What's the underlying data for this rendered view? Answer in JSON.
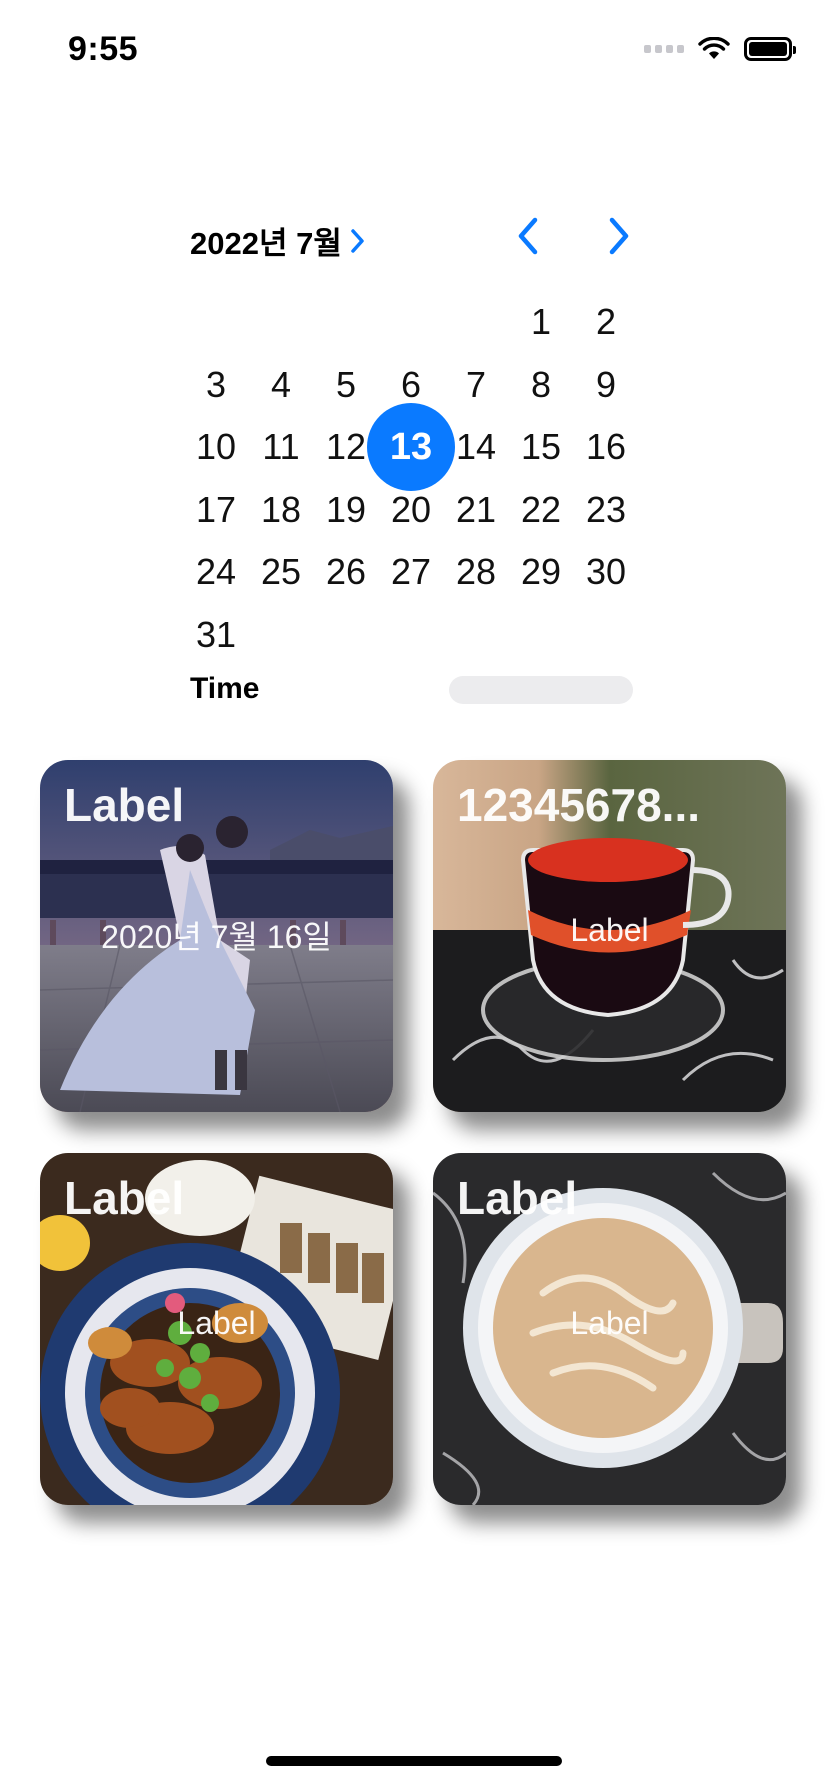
{
  "status": {
    "time": "9:55"
  },
  "calendar": {
    "month_title": "2022년 7월",
    "selected_day": 13,
    "days": [
      1,
      2,
      3,
      4,
      5,
      6,
      7,
      8,
      9,
      10,
      11,
      12,
      13,
      14,
      15,
      16,
      17,
      18,
      19,
      20,
      21,
      22,
      23,
      24,
      25,
      26,
      27,
      28,
      29,
      30,
      31
    ]
  },
  "time_row": {
    "label": "Time"
  },
  "cards": [
    {
      "title": "Label",
      "subtitle": "2020년 7월 16일"
    },
    {
      "title": "12345678...",
      "subtitle": "Label"
    },
    {
      "title": "Label",
      "subtitle": "Label"
    },
    {
      "title": "Label",
      "subtitle": "Label"
    }
  ],
  "colors": {
    "accent": "#0a7aff"
  }
}
